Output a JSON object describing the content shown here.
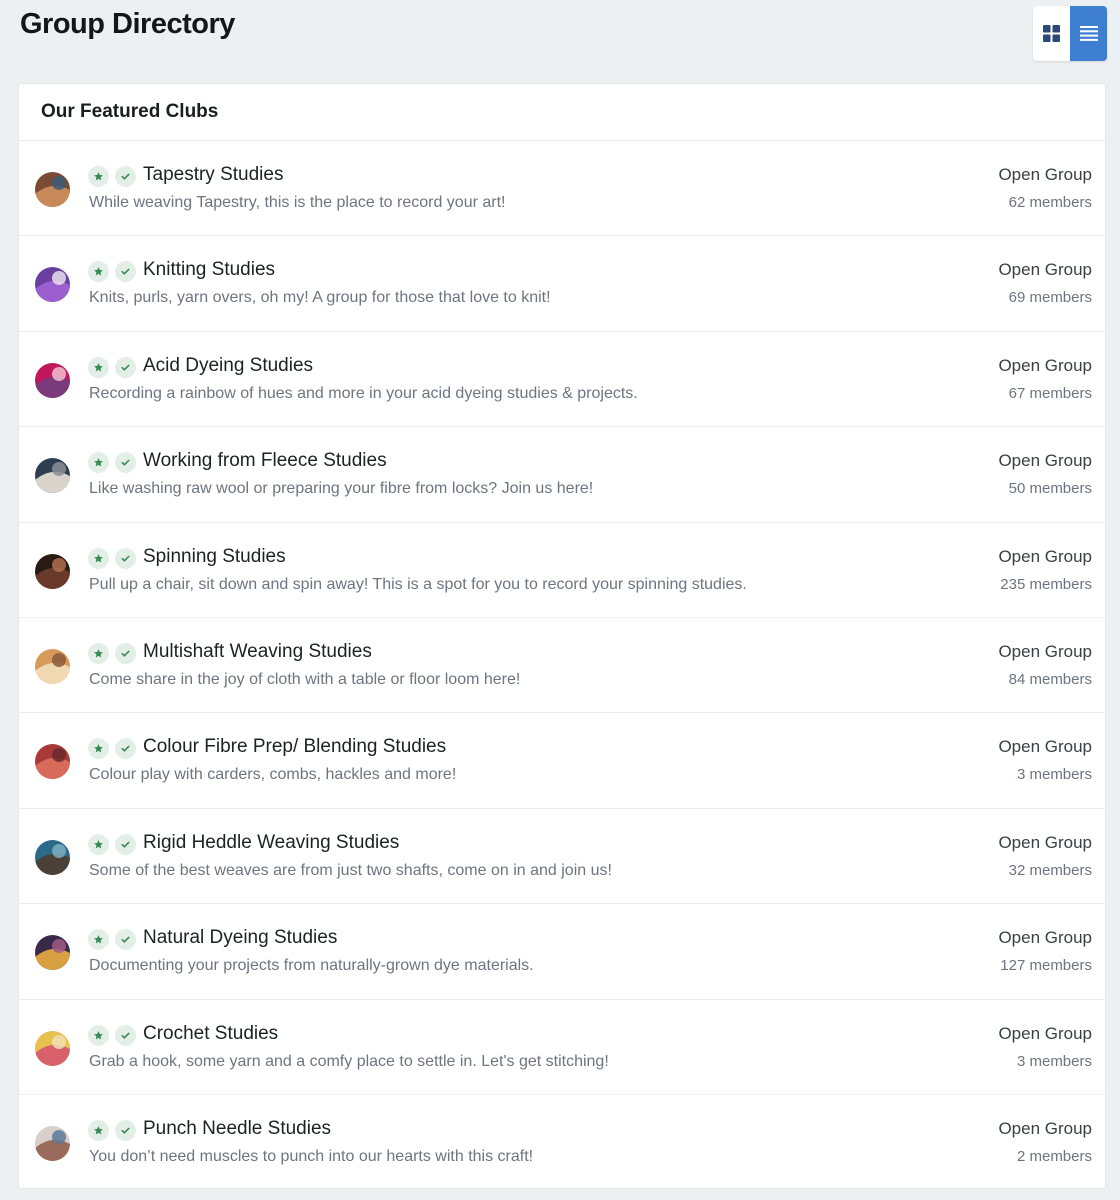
{
  "page": {
    "title": "Group Directory"
  },
  "view_toggle": {
    "options": [
      "grid-icon",
      "list-icon"
    ],
    "active": "list",
    "active_color": "#3f7fd1"
  },
  "panel": {
    "title": "Our Featured Clubs"
  },
  "badge_icons": [
    "star-icon",
    "check-icon"
  ],
  "badge_color": "#3a8a55",
  "clubs": [
    {
      "name": "Tapestry Studies",
      "description": "While weaving Tapestry, this is the place to record your art!",
      "type": "Open Group",
      "members": "62 members",
      "avatar_colors": [
        "#7a4a34",
        "#c98a5a",
        "#3d5a78"
      ]
    },
    {
      "name": "Knitting Studies",
      "description": "Knits, purls, yarn overs, oh my! A group for those that love to knit!",
      "type": "Open Group",
      "members": "69 members",
      "avatar_colors": [
        "#6b3fa0",
        "#9b5fd0",
        "#e6e0ea"
      ]
    },
    {
      "name": "Acid Dyeing Studies",
      "description": "Recording a rainbow of hues and more in your acid dyeing studies & projects.",
      "type": "Open Group",
      "members": "67 members",
      "avatar_colors": [
        "#c2185b",
        "#7b3a7a",
        "#f0c0d0"
      ]
    },
    {
      "name": "Working from Fleece Studies",
      "description": "Like washing raw wool or preparing your fibre from locks? Join us here!",
      "type": "Open Group",
      "members": "50 members",
      "avatar_colors": [
        "#2f3d52",
        "#d8d4cc",
        "#8a8f96"
      ]
    },
    {
      "name": "Spinning Studies",
      "description": "Pull up a chair, sit down and spin away! This is a spot for you to record your spinning studies.",
      "type": "Open Group",
      "members": "235 members",
      "avatar_colors": [
        "#2a1a14",
        "#6a3a28",
        "#b07050"
      ]
    },
    {
      "name": "Multishaft Weaving Studies",
      "description": "Come share in the joy of cloth with a table or floor loom here!",
      "type": "Open Group",
      "members": "84 members",
      "avatar_colors": [
        "#d89a5a",
        "#f0d8b0",
        "#8a5a3a"
      ]
    },
    {
      "name": "Colour Fibre Prep/ Blending Studies",
      "description": "Colour play with carders, combs, hackles and more!",
      "type": "Open Group",
      "members": "3 members",
      "avatar_colors": [
        "#a83a3a",
        "#d86a5a",
        "#6a2a2a"
      ]
    },
    {
      "name": "Rigid Heddle Weaving Studies",
      "description": "Some of the best weaves are from just two shafts, come on in and join us!",
      "type": "Open Group",
      "members": "32 members",
      "avatar_colors": [
        "#2a6a8a",
        "#4a4038",
        "#7ab0c0"
      ]
    },
    {
      "name": "Natural Dyeing Studies",
      "description": "Documenting your projects from naturally-grown dye materials.",
      "type": "Open Group",
      "members": "127 members",
      "avatar_colors": [
        "#3a2a4a",
        "#d8a040",
        "#a05a8a"
      ]
    },
    {
      "name": "Crochet Studies",
      "description": "Grab a hook, some yarn and a comfy place to settle in. Let's get stitching!",
      "type": "Open Group",
      "members": "3 members",
      "avatar_colors": [
        "#e8c050",
        "#d8606a",
        "#f0e0b0"
      ]
    },
    {
      "name": "Punch Needle Studies",
      "description": "You don’t need muscles to punch into our hearts with this craft!",
      "type": "Open Group",
      "members": "2 members",
      "avatar_colors": [
        "#d8d0c8",
        "#9a6a5a",
        "#5a7a9a"
      ]
    }
  ]
}
